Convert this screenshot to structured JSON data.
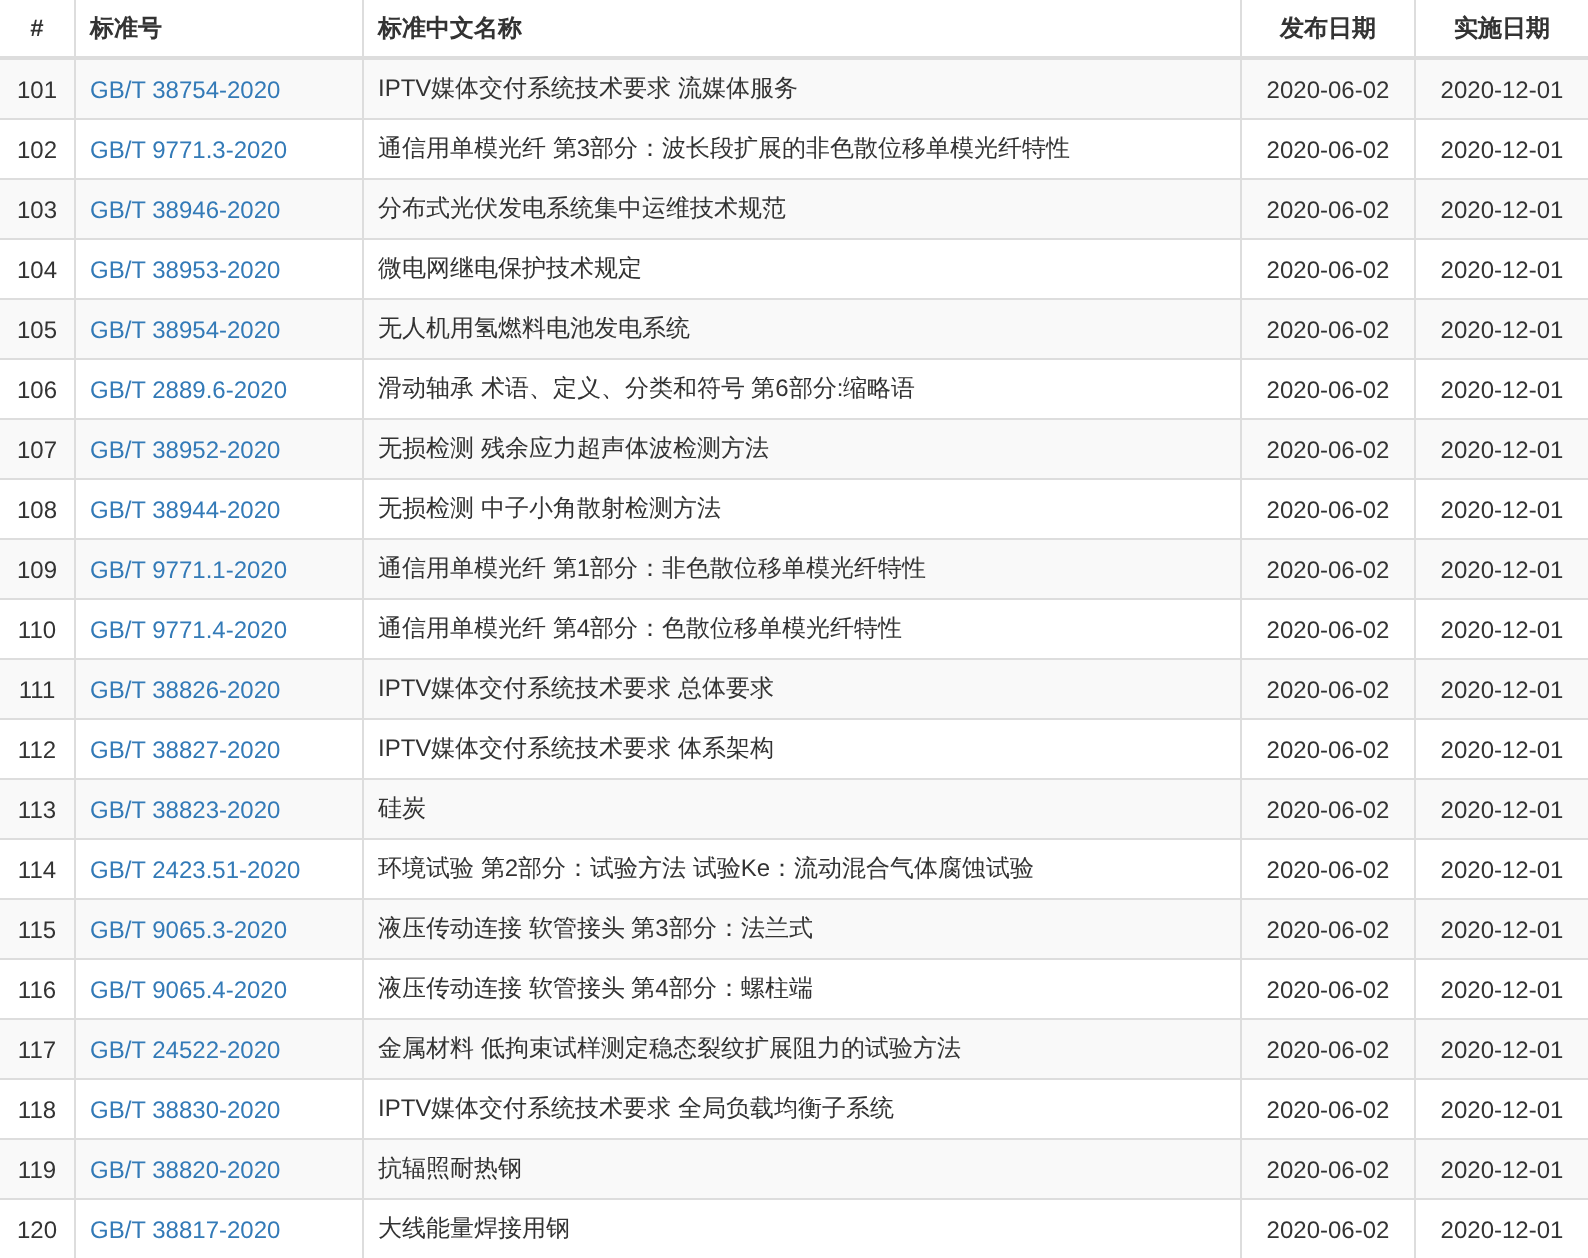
{
  "table": {
    "columns": [
      "#",
      "标准号",
      "标准中文名称",
      "发布日期",
      "实施日期"
    ],
    "rows": [
      {
        "index": "101",
        "code": "GB/T 38754-2020",
        "name": "IPTV媒体交付系统技术要求 流媒体服务",
        "published": "2020-06-02",
        "effective": "2020-12-01"
      },
      {
        "index": "102",
        "code": "GB/T 9771.3-2020",
        "name": "通信用单模光纤 第3部分：波长段扩展的非色散位移单模光纤特性",
        "published": "2020-06-02",
        "effective": "2020-12-01"
      },
      {
        "index": "103",
        "code": "GB/T 38946-2020",
        "name": "分布式光伏发电系统集中运维技术规范",
        "published": "2020-06-02",
        "effective": "2020-12-01"
      },
      {
        "index": "104",
        "code": "GB/T 38953-2020",
        "name": "微电网继电保护技术规定",
        "published": "2020-06-02",
        "effective": "2020-12-01"
      },
      {
        "index": "105",
        "code": "GB/T 38954-2020",
        "name": "无人机用氢燃料电池发电系统",
        "published": "2020-06-02",
        "effective": "2020-12-01"
      },
      {
        "index": "106",
        "code": "GB/T 2889.6-2020",
        "name": "滑动轴承 术语、定义、分类和符号 第6部分:缩略语",
        "published": "2020-06-02",
        "effective": "2020-12-01"
      },
      {
        "index": "107",
        "code": "GB/T 38952-2020",
        "name": "无损检测 残余应力超声体波检测方法",
        "published": "2020-06-02",
        "effective": "2020-12-01"
      },
      {
        "index": "108",
        "code": "GB/T 38944-2020",
        "name": "无损检测 中子小角散射检测方法",
        "published": "2020-06-02",
        "effective": "2020-12-01"
      },
      {
        "index": "109",
        "code": "GB/T 9771.1-2020",
        "name": "通信用单模光纤 第1部分：非色散位移单模光纤特性",
        "published": "2020-06-02",
        "effective": "2020-12-01"
      },
      {
        "index": "110",
        "code": "GB/T 9771.4-2020",
        "name": "通信用单模光纤 第4部分：色散位移单模光纤特性",
        "published": "2020-06-02",
        "effective": "2020-12-01"
      },
      {
        "index": "111",
        "code": "GB/T 38826-2020",
        "name": "IPTV媒体交付系统技术要求 总体要求",
        "published": "2020-06-02",
        "effective": "2020-12-01"
      },
      {
        "index": "112",
        "code": "GB/T 38827-2020",
        "name": "IPTV媒体交付系统技术要求 体系架构",
        "published": "2020-06-02",
        "effective": "2020-12-01"
      },
      {
        "index": "113",
        "code": "GB/T 38823-2020",
        "name": "硅炭",
        "published": "2020-06-02",
        "effective": "2020-12-01"
      },
      {
        "index": "114",
        "code": "GB/T 2423.51-2020",
        "name": "环境试验 第2部分：试验方法 试验Ke：流动混合气体腐蚀试验",
        "published": "2020-06-02",
        "effective": "2020-12-01"
      },
      {
        "index": "115",
        "code": "GB/T 9065.3-2020",
        "name": "液压传动连接 软管接头 第3部分：法兰式",
        "published": "2020-06-02",
        "effective": "2020-12-01"
      },
      {
        "index": "116",
        "code": "GB/T 9065.4-2020",
        "name": "液压传动连接 软管接头 第4部分：螺柱端",
        "published": "2020-06-02",
        "effective": "2020-12-01"
      },
      {
        "index": "117",
        "code": "GB/T 24522-2020",
        "name": "金属材料 低拘束试样测定稳态裂纹扩展阻力的试验方法",
        "published": "2020-06-02",
        "effective": "2020-12-01"
      },
      {
        "index": "118",
        "code": "GB/T 38830-2020",
        "name": "IPTV媒体交付系统技术要求 全局负载均衡子系统",
        "published": "2020-06-02",
        "effective": "2020-12-01"
      },
      {
        "index": "119",
        "code": "GB/T 38820-2020",
        "name": "抗辐照耐热钢",
        "published": "2020-06-02",
        "effective": "2020-12-01"
      },
      {
        "index": "120",
        "code": "GB/T 38817-2020",
        "name": "大线能量焊接用钢",
        "published": "2020-06-02",
        "effective": "2020-12-01"
      }
    ]
  }
}
